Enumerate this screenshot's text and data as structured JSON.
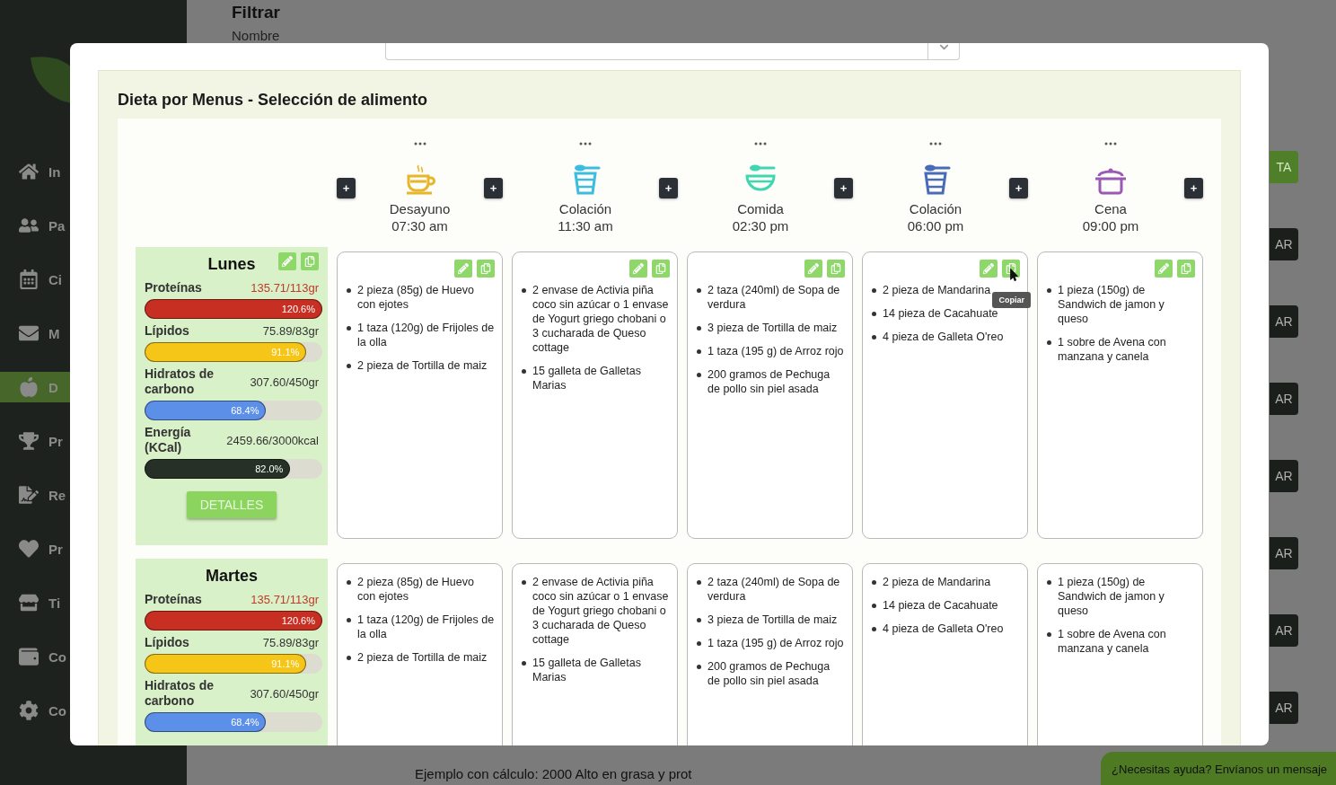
{
  "sidebar": {
    "items": [
      {
        "label": "In",
        "selected": false
      },
      {
        "label": "Pa",
        "selected": false
      },
      {
        "label": "Ci",
        "selected": false
      },
      {
        "label": "M",
        "selected": false
      },
      {
        "label": "D",
        "selected": true
      },
      {
        "label": "Pr",
        "selected": false
      },
      {
        "label": "Re",
        "selected": false
      },
      {
        "label": "Pr",
        "selected": false
      },
      {
        "label": "Ti",
        "selected": false
      },
      {
        "label": "Co",
        "selected": false
      },
      {
        "label": "Co",
        "selected": false
      }
    ]
  },
  "page": {
    "title": "Filtrar",
    "filter_label": "Nombre",
    "buttons": [
      {
        "label": "TA",
        "kind": "primary"
      },
      {
        "label": "AR",
        "kind": "dark"
      },
      {
        "label": "AR",
        "kind": "dark"
      },
      {
        "label": "AR",
        "kind": "dark"
      },
      {
        "label": "AR",
        "kind": "dark"
      },
      {
        "label": "AR",
        "kind": "dark"
      },
      {
        "label": "AR",
        "kind": "dark"
      },
      {
        "label": "AR",
        "kind": "dark"
      }
    ],
    "footer_text": "Ejemplo con cálculo: 2000 Alto en grasa y prot"
  },
  "modal": {
    "title": "Dieta por Menus - Selección de alimento",
    "leading_add": "+",
    "meals": [
      {
        "name": "Desayuno",
        "time": "07:30 am",
        "kind": "cup",
        "color": "#e8b62a",
        "add": "+"
      },
      {
        "name": "Colación",
        "time": "11:30 am",
        "kind": "yogurt",
        "color": "#3cbde0",
        "add": "+"
      },
      {
        "name": "Comida",
        "time": "02:30 pm",
        "kind": "bowl",
        "color": "#3fd6b0",
        "add": "+"
      },
      {
        "name": "Colación",
        "time": "06:00 pm",
        "kind": "yogurt",
        "color": "#4a6cb8",
        "add": "+"
      },
      {
        "name": "Cena",
        "time": "09:00 pm",
        "kind": "pot",
        "color": "#9b59b6",
        "add": "+"
      }
    ],
    "days": [
      {
        "name": "Lunes",
        "show_actions": true,
        "details_button": "DETALLES",
        "macros": [
          {
            "name": "Proteínas",
            "value": "135.71/113gr",
            "over": true,
            "percent": "120.6%",
            "level": 1,
            "color": "#c62f22"
          },
          {
            "name": "Lípidos",
            "value": "75.89/83gr",
            "over": false,
            "percent": "91.1%",
            "level": 0.911,
            "color": "#f5c518"
          },
          {
            "name": "Hidratos de carbono",
            "value": "307.60/450gr",
            "over": false,
            "percent": "68.4%",
            "level": 0.684,
            "color": "#5b8fe8"
          },
          {
            "name": "Energía (KCal)",
            "value": "2459.66/3000kcal",
            "over": false,
            "percent": "82.0%",
            "level": 0.82,
            "color": "#263026"
          }
        ],
        "cells": [
          {
            "items": [
              "2 pieza (85g) de Huevo con ejotes",
              "1 taza (120g) de Frijoles de la olla",
              "2 pieza de Tortilla de maiz"
            ]
          },
          {
            "items": [
              "2 envase de Activia piña coco sin azúcar o 1 envase de Yogurt griego chobani o 3 cucharada de Queso cottage",
              "15 galleta de Galletas Marias"
            ]
          },
          {
            "items": [
              "2 taza (240ml) de Sopa de verdura",
              "3 pieza de Tortilla de maiz",
              "1 taza (195 g) de Arroz rojo",
              "200 gramos de Pechuga de pollo sin piel asada"
            ]
          },
          {
            "items": [
              "2 pieza de Mandarina",
              "14 pieza de Cacahuate",
              "4 pieza de Galleta O'reo"
            ],
            "tooltip": "Copiar"
          },
          {
            "items": [
              "1 pieza (150g) de Sandwich de jamon y queso",
              "1 sobre de Avena con manzana y canela"
            ]
          }
        ]
      },
      {
        "name": "Martes",
        "show_actions": false,
        "macros": [
          {
            "name": "Proteínas",
            "value": "135.71/113gr",
            "over": true,
            "percent": "120.6%",
            "level": 1,
            "color": "#c62f22"
          },
          {
            "name": "Lípidos",
            "value": "75.89/83gr",
            "over": false,
            "percent": "91.1%",
            "level": 0.911,
            "color": "#f5c518"
          },
          {
            "name": "Hidratos de carbono",
            "value": "307.60/450gr",
            "over": false,
            "percent": "68.4%",
            "level": 0.684,
            "color": "#5b8fe8"
          }
        ],
        "cells": [
          {
            "items": [
              "2 pieza (85g) de Huevo con ejotes",
              "1 taza (120g) de Frijoles de la olla",
              "2 pieza de Tortilla de maiz"
            ]
          },
          {
            "items": [
              "2 envase de Activia piña coco sin azúcar o 1 envase de Yogurt griego chobani o 3 cucharada de Queso cottage",
              "15 galleta de Galletas Marias"
            ]
          },
          {
            "items": [
              "2 taza (240ml) de Sopa de verdura",
              "3 pieza de Tortilla de maiz",
              "1 taza (195 g) de Arroz rojo",
              "200 gramos de Pechuga de pollo sin piel asada"
            ]
          },
          {
            "items": [
              "2 pieza de Mandarina",
              "14 pieza de Cacahuate",
              "4 pieza de Galleta O'reo"
            ]
          },
          {
            "items": [
              "1 pieza (150g) de Sandwich de jamon y queso",
              "1 sobre de Avena con manzana y canela"
            ]
          }
        ]
      }
    ]
  },
  "help_chat": {
    "label": "¿Necesitas ayuda? Envíanos un mensaje"
  }
}
